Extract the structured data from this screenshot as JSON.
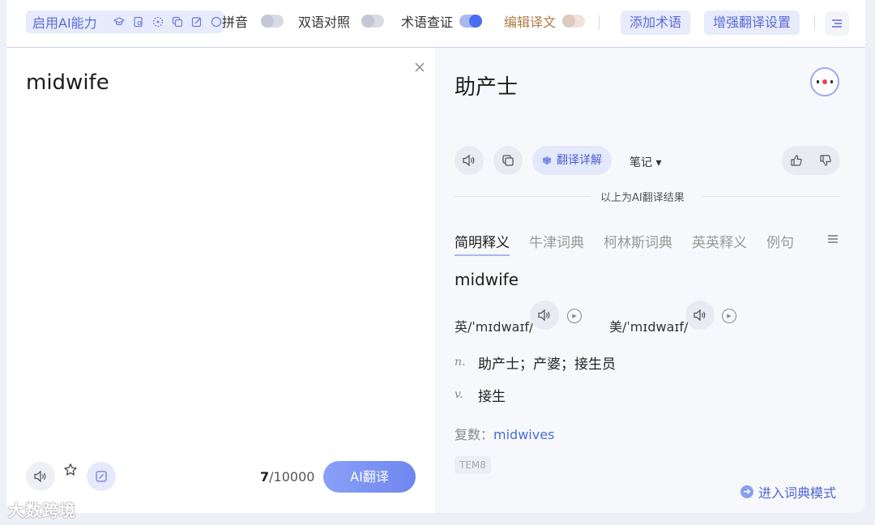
{
  "toolbar": {
    "ai_label": "启用AI能力",
    "ai_tools": [
      "mortarboard-icon",
      "doc-search-icon",
      "target-icon",
      "copy-doc-icon",
      "edit-icon"
    ],
    "pinyin_label": "拼音",
    "bilingual_label": "双语对照",
    "term_check_label": "术语查证",
    "edit_translation_label": "编辑译文",
    "add_term_label": "添加术语",
    "enhance_label": "增强翻译设置"
  },
  "source": {
    "text": "midwife",
    "char_count": "7",
    "char_limit": "/10000",
    "translate_button": "AI翻译"
  },
  "result": {
    "text": "助产士",
    "explain_button": "翻译详解",
    "notes_label": "笔记 ▾",
    "ai_note": "以上为AI翻译结果"
  },
  "dict": {
    "tabs": [
      "简明释义",
      "牛津词典",
      "柯林斯词典",
      "英英释义",
      "例句"
    ],
    "word": "midwife",
    "uk": "英/ˈmɪdwaɪf/",
    "us": "美/ˈmɪdwaɪf/",
    "defs": [
      {
        "pos": "n.",
        "text": "助产士；产婆；接生员"
      },
      {
        "pos": "v.",
        "text": "接生"
      }
    ],
    "plural_label": "复数：",
    "plural_value": "midwives",
    "tag": "TEM8",
    "dict_mode_link": "进入词典模式"
  },
  "watermark": "大数跨境",
  "colors": {
    "accent": "#4a6cf0",
    "accent_light": "#e7ebfb"
  }
}
